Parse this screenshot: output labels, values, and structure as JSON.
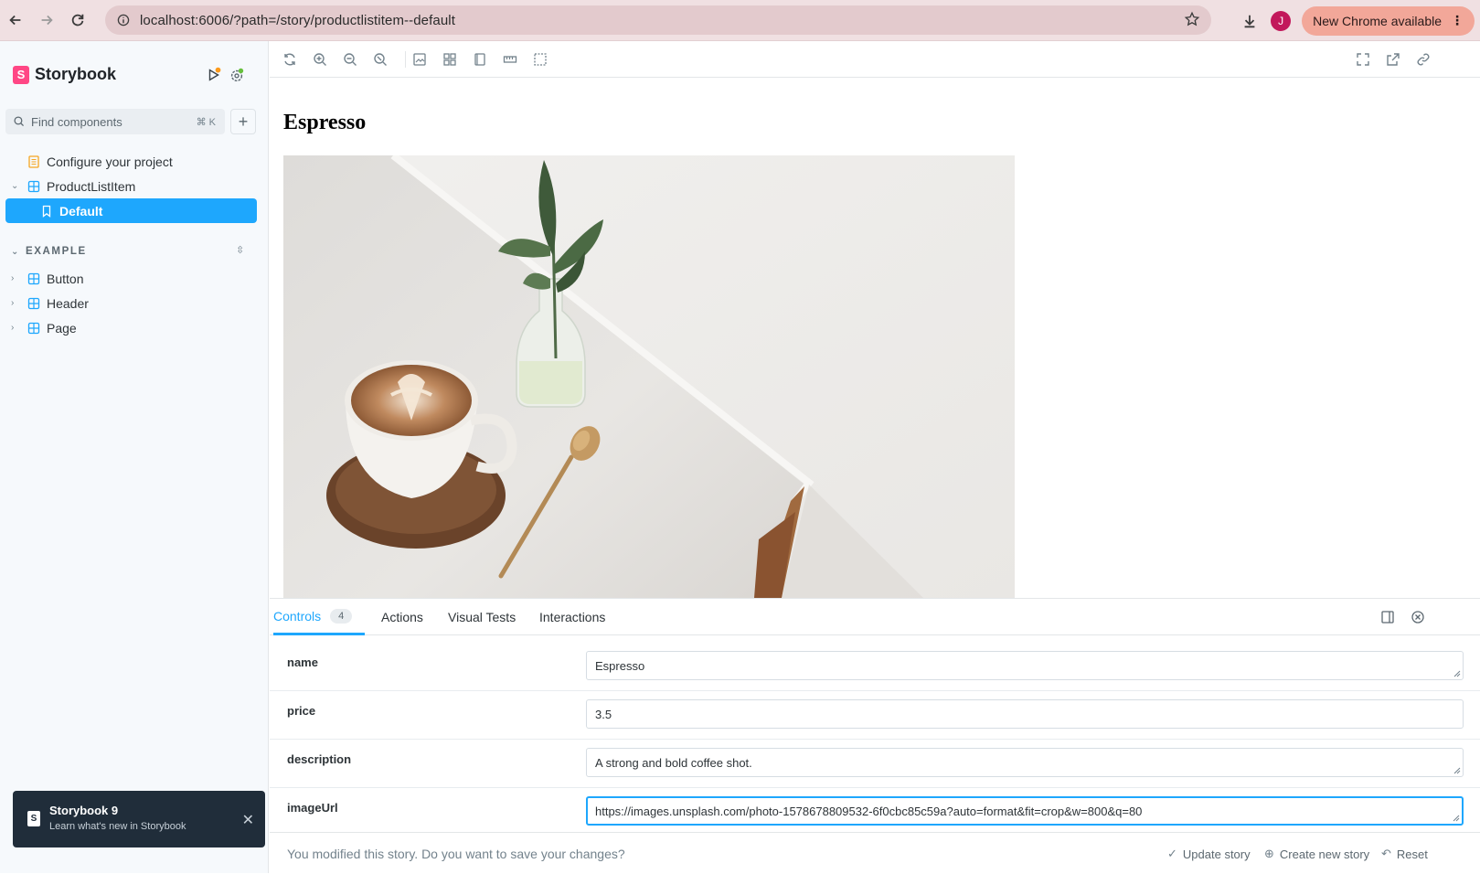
{
  "browser": {
    "url": "localhost:6006/?path=/story/productlistitem--default",
    "avatar_letter": "J",
    "update_label": "New Chrome available"
  },
  "sidebar": {
    "brand": "Storybook",
    "search_placeholder": "Find components",
    "search_shortcut": "⌘ K",
    "items": [
      {
        "label": "Configure your project",
        "icon": "document-icon"
      },
      {
        "label": "ProductListItem",
        "icon": "component-icon",
        "expanded": true
      },
      {
        "label": "Default",
        "icon": "bookmark-icon",
        "selected": true
      }
    ],
    "section": {
      "label": "EXAMPLE",
      "items": [
        {
          "label": "Button",
          "icon": "component-icon"
        },
        {
          "label": "Header",
          "icon": "component-icon"
        },
        {
          "label": "Page",
          "icon": "component-icon"
        }
      ]
    },
    "toast": {
      "title": "Storybook 9",
      "subtitle": "Learn what's new in Storybook"
    }
  },
  "preview": {
    "title": "Espresso"
  },
  "addons": {
    "tabs": [
      {
        "label": "Controls",
        "badge": "4",
        "active": true
      },
      {
        "label": "Actions"
      },
      {
        "label": "Visual Tests"
      },
      {
        "label": "Interactions"
      }
    ],
    "controls": [
      {
        "name": "name",
        "value": "Espresso"
      },
      {
        "name": "price",
        "value": "3.5"
      },
      {
        "name": "description",
        "value": "A strong and bold coffee shot."
      },
      {
        "name": "imageUrl",
        "value": "https://images.unsplash.com/photo-1578678809532-6f0cbc85c59a?auto=format&fit=crop&w=800&q=80"
      }
    ],
    "save_message": "You modified this story. Do you want to save your changes?",
    "update_story": "Update story",
    "create_story": "Create new story",
    "reset": "Reset"
  },
  "colors": {
    "accent": "#1ea7fd",
    "brand": "#ff4785"
  }
}
